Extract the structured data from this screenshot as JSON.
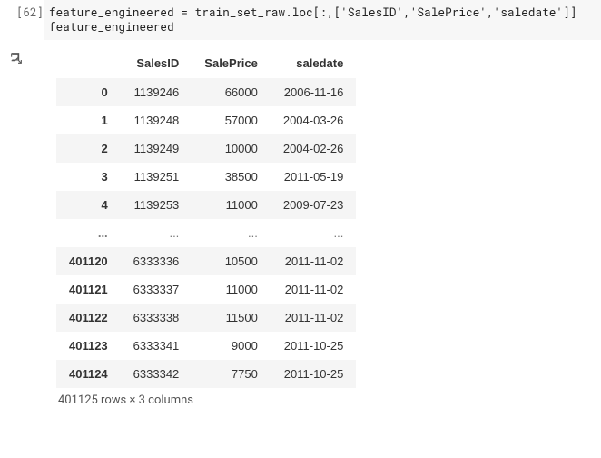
{
  "cell": {
    "prompt": "[62]",
    "code_line1": "feature_engineered = train_set_raw.loc[:,['SalesID','SalePrice','saledate']]",
    "code_line2": "feature_engineered"
  },
  "chart_data": {
    "type": "table",
    "columns": [
      "SalesID",
      "SalePrice",
      "saledate"
    ],
    "title": "",
    "index": [
      "0",
      "1",
      "2",
      "3",
      "4",
      "...",
      "401120",
      "401121",
      "401122",
      "401123",
      "401124"
    ],
    "rows": [
      {
        "idx": "0",
        "SalesID": "1139246",
        "SalePrice": "66000",
        "saledate": "2006-11-16"
      },
      {
        "idx": "1",
        "SalesID": "1139248",
        "SalePrice": "57000",
        "saledate": "2004-03-26"
      },
      {
        "idx": "2",
        "SalesID": "1139249",
        "SalePrice": "10000",
        "saledate": "2004-02-26"
      },
      {
        "idx": "3",
        "SalesID": "1139251",
        "SalePrice": "38500",
        "saledate": "2011-05-19"
      },
      {
        "idx": "4",
        "SalesID": "1139253",
        "SalePrice": "11000",
        "saledate": "2009-07-23"
      },
      {
        "idx": "...",
        "SalesID": "...",
        "SalePrice": "...",
        "saledate": "..."
      },
      {
        "idx": "401120",
        "SalesID": "6333336",
        "SalePrice": "10500",
        "saledate": "2011-11-02"
      },
      {
        "idx": "401121",
        "SalesID": "6333337",
        "SalePrice": "11000",
        "saledate": "2011-11-02"
      },
      {
        "idx": "401122",
        "SalesID": "6333338",
        "SalePrice": "11500",
        "saledate": "2011-11-02"
      },
      {
        "idx": "401123",
        "SalesID": "6333341",
        "SalePrice": "9000",
        "saledate": "2011-10-25"
      },
      {
        "idx": "401124",
        "SalesID": "6333342",
        "SalePrice": "7750",
        "saledate": "2011-10-25"
      }
    ],
    "shape_text": "401125 rows × 3 columns"
  }
}
